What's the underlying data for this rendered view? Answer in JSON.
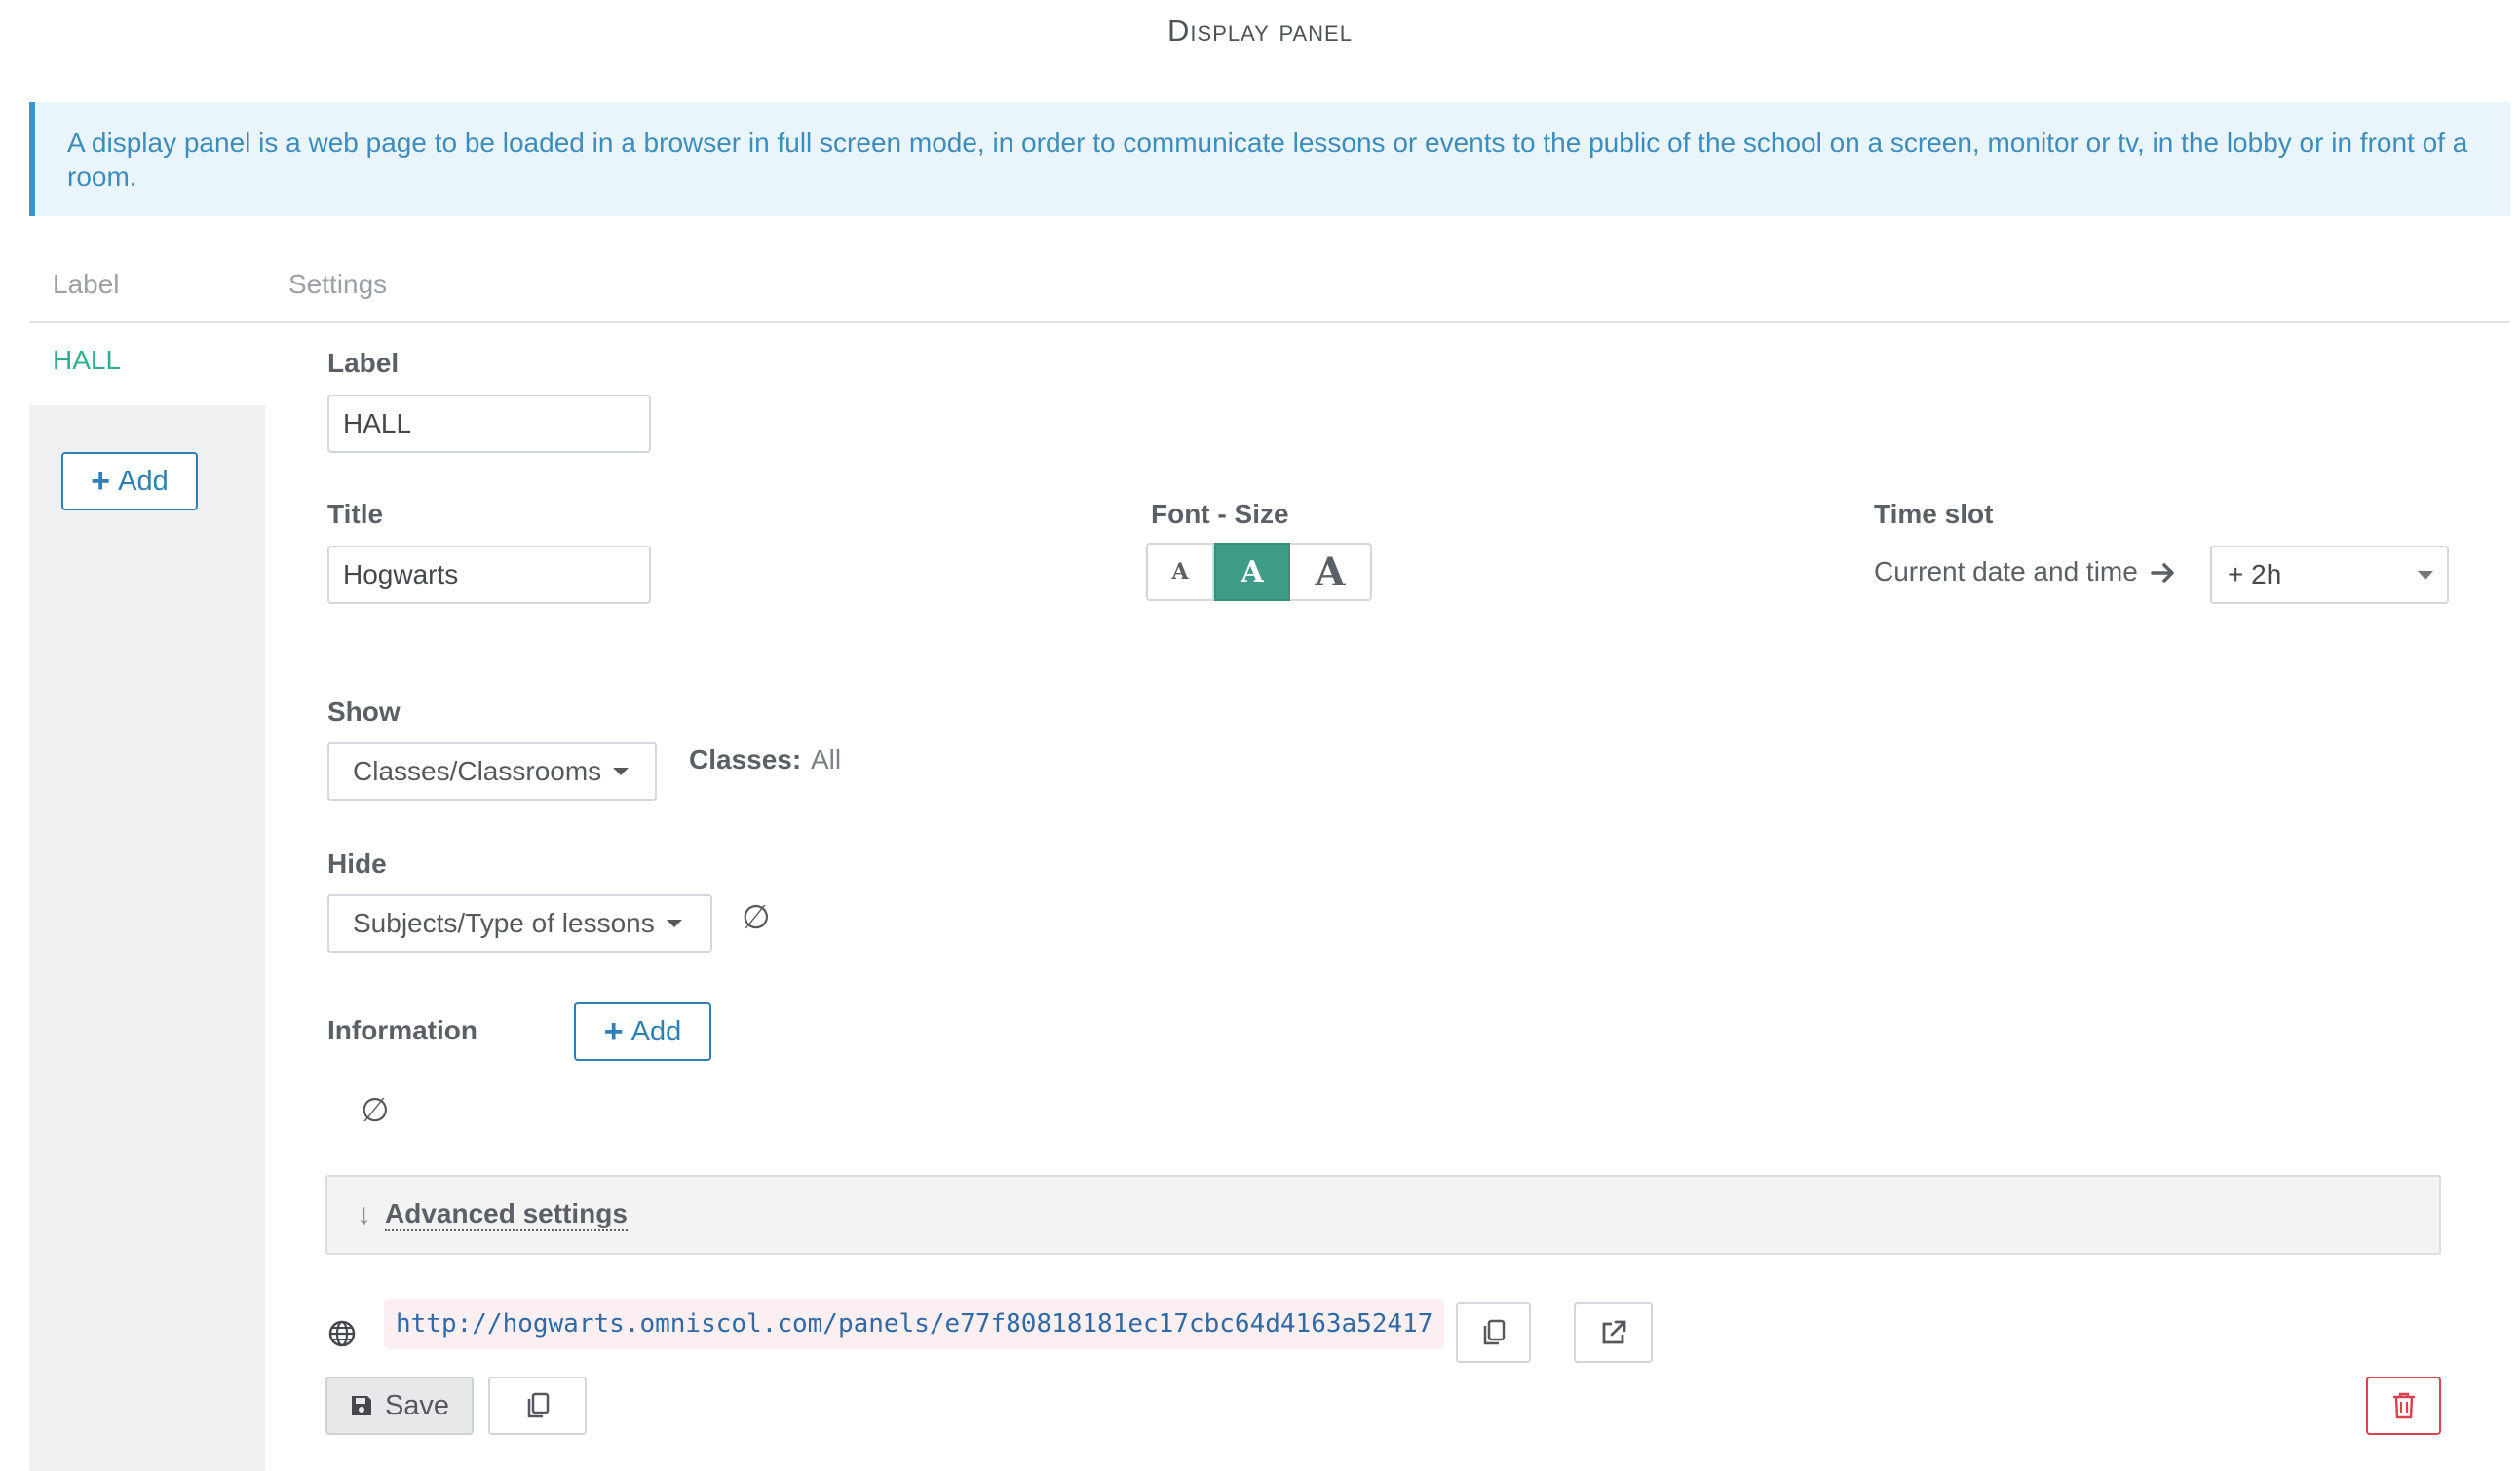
{
  "page": {
    "title": "Display panel"
  },
  "info": {
    "text": "A display panel is a web page to be loaded in a browser in full screen mode, in order to communicate lessons or events to the public of the school on a screen, monitor or tv, in the lobby or in front of a room."
  },
  "tabs": {
    "label": "Label",
    "settings": "Settings"
  },
  "sidebar": {
    "active_item": "HALL",
    "add_label": "Add"
  },
  "form": {
    "label": {
      "title": "Label",
      "value": "HALL"
    },
    "title": {
      "title": "Title",
      "value": "Hogwarts"
    },
    "font_size": {
      "title": "Font - Size",
      "small": "A",
      "medium": "A",
      "large": "A",
      "selected": "medium"
    },
    "time_slot": {
      "title": "Time slot",
      "text": "Current date and time",
      "value": "+ 2h"
    },
    "show": {
      "title": "Show",
      "value": "Classes/Classrooms",
      "classes_label": "Classes:",
      "classes_value": "All"
    },
    "hide": {
      "title": "Hide",
      "value": "Subjects/Type of lessons",
      "empty_symbol": "∅"
    },
    "information": {
      "title": "Information",
      "add_label": "Add",
      "empty_symbol": "∅"
    },
    "advanced": {
      "label": "Advanced settings"
    },
    "url": "http://hogwarts.omniscol.com/panels/e77f80818181ec17cbc64d4163a52417",
    "save_label": "Save"
  },
  "colors": {
    "accent": "#3f9c86",
    "link": "#2f7fb6",
    "info_bg": "#e9f4fb",
    "danger": "#d9434f"
  }
}
